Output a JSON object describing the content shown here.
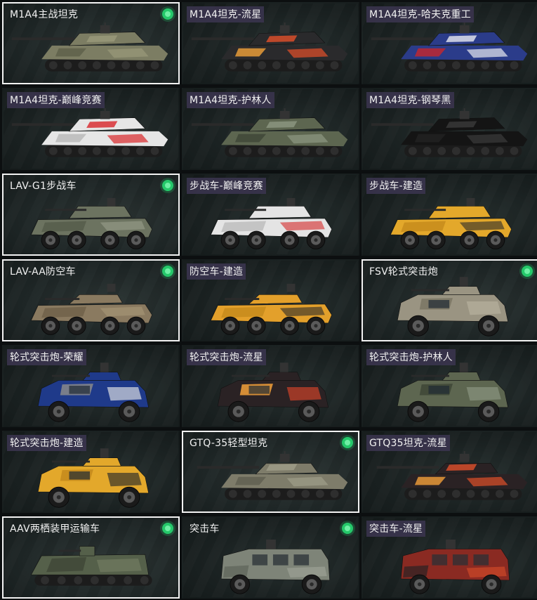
{
  "vehicles": [
    {
      "name": "M1A4主战坦克",
      "owned": true,
      "selected": true,
      "shape": "tank",
      "body": "#7c7d63",
      "accent": "#9a9a7a",
      "camo": "#5c5f48"
    },
    {
      "name": "M1A4坦克-流星",
      "owned": false,
      "selected": false,
      "shape": "tank",
      "body": "#2a2a2c",
      "accent": "#e4502a",
      "camo": "#f2a33a"
    },
    {
      "name": "M1A4坦克-哈夫克重工",
      "owned": false,
      "selected": false,
      "shape": "tank",
      "body": "#2b3c8a",
      "accent": "#e8e8f0",
      "camo": "#c8262a"
    },
    {
      "name": "M1A4坦克-巅峰竞赛",
      "owned": false,
      "selected": false,
      "shape": "tank",
      "body": "#e6e6e6",
      "accent": "#d8262a",
      "camo": "#b8b8b8"
    },
    {
      "name": "M1A4坦克-护林人",
      "owned": false,
      "selected": false,
      "shape": "tank",
      "body": "#5d6650",
      "accent": "#8e9882",
      "camo": "#3e4636"
    },
    {
      "name": "M1A4坦克-钢琴黑",
      "owned": false,
      "selected": false,
      "shape": "tank",
      "body": "#141414",
      "accent": "#3a3a3a",
      "camo": "#222222"
    },
    {
      "name": "LAV-G1步战车",
      "owned": true,
      "selected": true,
      "shape": "ifv",
      "body": "#6c7360",
      "accent": "#9a9f8c",
      "camo": "#555b4a"
    },
    {
      "name": "步战车-巅峰竞赛",
      "owned": false,
      "selected": false,
      "shape": "ifv",
      "body": "#e4e4e4",
      "accent": "#d62a2a",
      "camo": "#bcbcbc"
    },
    {
      "name": "步战车-建造",
      "owned": false,
      "selected": false,
      "shape": "ifv",
      "body": "#e3a82b",
      "accent": "#2a2a2a",
      "camo": "#c48a1c"
    },
    {
      "name": "LAV-AA防空车",
      "owned": true,
      "selected": true,
      "shape": "aa",
      "body": "#8a7a60",
      "accent": "#a89878",
      "camo": "#6e6048"
    },
    {
      "name": "防空车-建造",
      "owned": false,
      "selected": false,
      "shape": "aa",
      "body": "#e3a02b",
      "accent": "#2a2a2a",
      "camo": "#c48a1c"
    },
    {
      "name": "FSV轮式突击炮",
      "owned": true,
      "selected": true,
      "shape": "fsv",
      "body": "#9a9482",
      "accent": "#b8b2a0",
      "camo": "#7a7564"
    },
    {
      "name": "轮式突击炮-荣耀",
      "owned": false,
      "selected": false,
      "shape": "fsv",
      "body": "#1f3a8a",
      "accent": "#e6e6e6",
      "camo": "#8a8a8a"
    },
    {
      "name": "轮式突击炮-流星",
      "owned": false,
      "selected": false,
      "shape": "fsv",
      "body": "#2a2224",
      "accent": "#d8452a",
      "camo": "#f2a03a"
    },
    {
      "name": "轮式突击炮-护林人",
      "owned": false,
      "selected": false,
      "shape": "fsv",
      "body": "#5d6650",
      "accent": "#8e9882",
      "camo": "#3e4636"
    },
    {
      "name": "轮式突击炮-建造",
      "owned": false,
      "selected": false,
      "shape": "fsv",
      "body": "#e3a82b",
      "accent": "#2a2a2a",
      "camo": "#c48a1c"
    },
    {
      "name": "GTQ-35轻型坦克",
      "owned": true,
      "selected": true,
      "shape": "light",
      "body": "#7e7c6a",
      "accent": "#a09e8a",
      "camo": "#5f5e50"
    },
    {
      "name": "GTQ35坦克-流星",
      "owned": false,
      "selected": false,
      "shape": "light",
      "body": "#2a2224",
      "accent": "#e0502a",
      "camo": "#f2a03a"
    },
    {
      "name": "AAV两栖装甲运输车",
      "owned": true,
      "selected": true,
      "shape": "aav",
      "body": "#55604a",
      "accent": "#7a8468",
      "camo": "#3e4636"
    },
    {
      "name": "突击车",
      "owned": true,
      "selected": false,
      "shape": "assault",
      "body": "#7e8478",
      "accent": "#a4aa9c",
      "camo": "#5e6458"
    },
    {
      "name": "突击车-流星",
      "owned": false,
      "selected": false,
      "shape": "assault",
      "body": "#8a2a22",
      "accent": "#e0502a",
      "camo": "#2a2224"
    }
  ]
}
